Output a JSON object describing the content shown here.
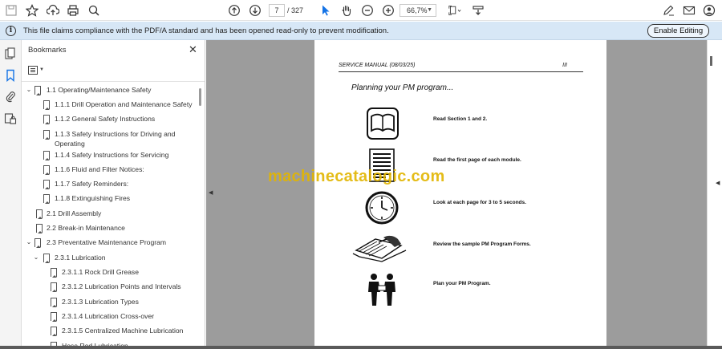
{
  "toolbar": {
    "page_current": "7",
    "page_total": "/ 327",
    "zoom": "66,7%"
  },
  "infobar": {
    "message": "This file claims compliance with the PDF/A standard and has been opened read-only to prevent modification.",
    "enable_label": "Enable Editing"
  },
  "panel": {
    "title": "Bookmarks",
    "items": [
      {
        "label": "1.1 Operating/Maintenance Safety"
      },
      {
        "label": "1.1.1 Drill Operation and Maintenance Safety"
      },
      {
        "label": "1.1.2 General Safety Instructions"
      },
      {
        "label": "1.1.3 Safety Instructions for Driving and"
      },
      {
        "label": "Operating"
      },
      {
        "label": "1.1.4 Safety Instructions for Servicing"
      },
      {
        "label": "1.1.6 Fluid and Filter Notices:"
      },
      {
        "label": "1.1.7 Safety Reminders:"
      },
      {
        "label": "1.1.8 Extinguishing Fires"
      },
      {
        "label": "2.1 Drill Assembly"
      },
      {
        "label": "2.2 Break-in Maintenance"
      },
      {
        "label": "2.3 Preventative Maintenance Program"
      },
      {
        "label": "2.3.1 Lubrication"
      },
      {
        "label": "2.3.1.1 Rock Drill Grease"
      },
      {
        "label": "2.3.1.2 Lubrication Points and Intervals"
      },
      {
        "label": "2.3.1.3 Lubrication Types"
      },
      {
        "label": "2.3.1.4 Lubrication Cross-over"
      },
      {
        "label": "2.3.1.5 Centralized Machine Lubrication"
      },
      {
        "label": "Hose Rod Lubrication"
      }
    ]
  },
  "document": {
    "header_left": "SERVICE MANUAL (08/03/25)",
    "header_right": "III",
    "heading": "Planning your PM program...",
    "steps": [
      "Read Section 1 and 2.",
      "Read the first page of each module.",
      "Look at each page for 3 to 5 seconds.",
      "Review the sample PM Program Forms.",
      "Plan your PM Program."
    ]
  },
  "watermark": "machinecatalogic.com"
}
